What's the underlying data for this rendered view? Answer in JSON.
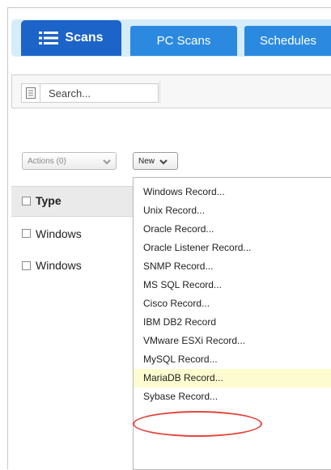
{
  "tabs": {
    "active_label": "Scans",
    "pc_label": "PC Scans",
    "schedules_label": "Schedules"
  },
  "search": {
    "placeholder": "Search..."
  },
  "toolbar": {
    "actions_label": "Actions (0)",
    "new_label": "New"
  },
  "table": {
    "header_type": "Type",
    "rows": [
      "Windows",
      "Windows"
    ]
  },
  "menu": {
    "items": [
      "Windows Record...",
      "Unix Record...",
      "Oracle Record...",
      "Oracle Listener Record...",
      "SNMP Record...",
      "MS SQL Record...",
      "Cisco Record...",
      "IBM DB2 Record",
      "VMware ESXi Record...",
      "MySQL Record...",
      "MariaDB Record...",
      "Sybase Record..."
    ],
    "highlighted": "MariaDB Record..."
  },
  "colors": {
    "active_tab": "#1c64c7",
    "tab": "#2b8ae0",
    "tabbar": "#d6ecf9",
    "highlight": "#fdfcd0",
    "annotation": "#e2453c"
  }
}
